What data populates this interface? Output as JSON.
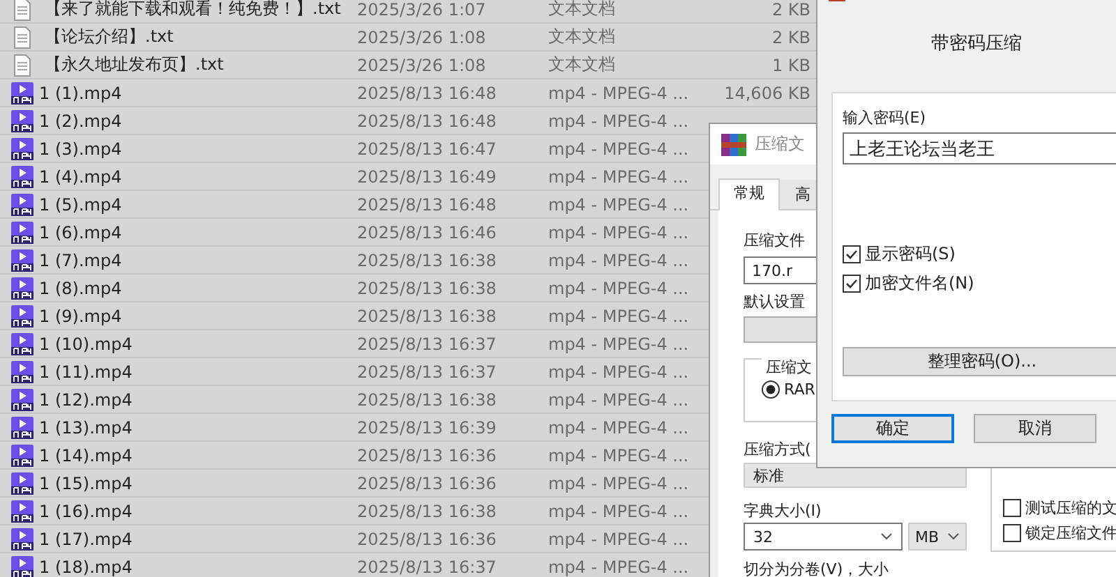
{
  "file_list": {
    "rows": [
      {
        "kind": "text",
        "name": "【来了就能下载和观看！纯免费！】.txt",
        "modified": "2025/3/26 1:07",
        "type": "文本文档",
        "size": "2 KB"
      },
      {
        "kind": "text",
        "name": "【论坛介绍】.txt",
        "modified": "2025/3/26 1:08",
        "type": "文本文档",
        "size": "2 KB"
      },
      {
        "kind": "text",
        "name": "【永久地址发布页】.txt",
        "modified": "2025/3/26 1:08",
        "type": "文本文档",
        "size": "1 KB"
      },
      {
        "kind": "video",
        "name": "1 (1).mp4",
        "modified": "2025/8/13 16:48",
        "type": "mp4 - MPEG-4 ...",
        "size": "14,606 KB"
      },
      {
        "kind": "video",
        "name": "1 (2).mp4",
        "modified": "2025/8/13 16:48",
        "type": "mp4 - MPEG-4 ..."
      },
      {
        "kind": "video",
        "name": "1 (3).mp4",
        "modified": "2025/8/13 16:47",
        "type": "mp4 - MPEG-4 ..."
      },
      {
        "kind": "video",
        "name": "1 (4).mp4",
        "modified": "2025/8/13 16:49",
        "type": "mp4 - MPEG-4 ..."
      },
      {
        "kind": "video",
        "name": "1 (5).mp4",
        "modified": "2025/8/13 16:48",
        "type": "mp4 - MPEG-4 ..."
      },
      {
        "kind": "video",
        "name": "1 (6).mp4",
        "modified": "2025/8/13 16:46",
        "type": "mp4 - MPEG-4 ..."
      },
      {
        "kind": "video",
        "name": "1 (7).mp4",
        "modified": "2025/8/13 16:38",
        "type": "mp4 - MPEG-4 ..."
      },
      {
        "kind": "video",
        "name": "1 (8).mp4",
        "modified": "2025/8/13 16:38",
        "type": "mp4 - MPEG-4 ..."
      },
      {
        "kind": "video",
        "name": "1 (9).mp4",
        "modified": "2025/8/13 16:38",
        "type": "mp4 - MPEG-4 ..."
      },
      {
        "kind": "video",
        "name": "1 (10).mp4",
        "modified": "2025/8/13 16:37",
        "type": "mp4 - MPEG-4 ..."
      },
      {
        "kind": "video",
        "name": "1 (11).mp4",
        "modified": "2025/8/13 16:37",
        "type": "mp4 - MPEG-4 ..."
      },
      {
        "kind": "video",
        "name": "1 (12).mp4",
        "modified": "2025/8/13 16:38",
        "type": "mp4 - MPEG-4 ..."
      },
      {
        "kind": "video",
        "name": "1 (13).mp4",
        "modified": "2025/8/13 16:39",
        "type": "mp4 - MPEG-4 ..."
      },
      {
        "kind": "video",
        "name": "1 (14).mp4",
        "modified": "2025/8/13 16:36",
        "type": "mp4 - MPEG-4 ..."
      },
      {
        "kind": "video",
        "name": "1 (15).mp4",
        "modified": "2025/8/13 16:36",
        "type": "mp4 - MPEG-4 ..."
      },
      {
        "kind": "video",
        "name": "1 (16).mp4",
        "modified": "2025/8/13 16:38",
        "type": "mp4 - MPEG-4 ..."
      },
      {
        "kind": "video",
        "name": "1 (17).mp4",
        "modified": "2025/8/13 16:36",
        "type": "mp4 - MPEG-4 ..."
      },
      {
        "kind": "video",
        "name": "1 (18).mp4",
        "modified": "2025/8/13 16:37",
        "type": "mp4 - MPEG-4 ..."
      }
    ]
  },
  "compress_dialog": {
    "title": "压缩文",
    "tabs": [
      {
        "label": "常规",
        "selected": true
      },
      {
        "label": "高",
        "selected": false
      }
    ],
    "archive_name_label": "压缩文件",
    "archive_name": "170.r",
    "default_settings_label": "默认设置",
    "format_group_label": "压缩文",
    "format_options": [
      {
        "label": "RAR",
        "selected": true
      }
    ],
    "method_label": "压缩方式(",
    "method": "标准",
    "dictionary_label": "字典大小(I)",
    "dictionary": "32",
    "dictionary_unit": "MB",
    "split_label": "切分为分卷(V)，大小",
    "options": [
      {
        "label": "测试压缩的文",
        "checked": false
      },
      {
        "label": "锁定压缩文件",
        "checked": false
      }
    ]
  },
  "password_dialog": {
    "header": "带密码压缩",
    "password_label": "输入密码(E)",
    "password": "上老王论坛当老王",
    "checkboxes": [
      {
        "label": "显示密码(S)",
        "checked": true
      },
      {
        "label": "加密文件名(N)",
        "checked": true
      }
    ],
    "manage_button": "整理密码(O)...",
    "buttons": [
      {
        "label": "确定",
        "focused": true
      },
      {
        "label": "取消",
        "focused": false
      }
    ]
  }
}
